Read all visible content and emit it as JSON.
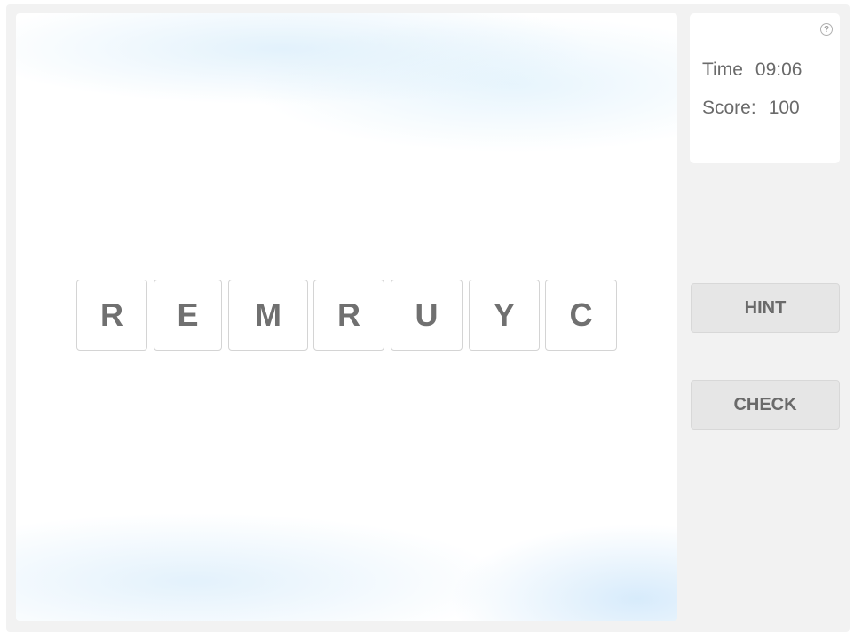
{
  "tiles": [
    "R",
    "E",
    "M",
    "R",
    "U",
    "Y",
    "C"
  ],
  "stats": {
    "time_label": "Time",
    "time_value": "09:06",
    "score_label": "Score:",
    "score_value": "100",
    "help_icon": "?"
  },
  "buttons": {
    "hint": "HINT",
    "check": "CHECK"
  }
}
